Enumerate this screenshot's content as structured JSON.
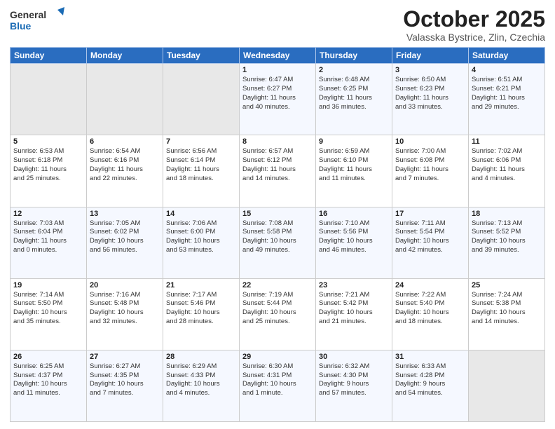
{
  "header": {
    "logo_line1": "General",
    "logo_line2": "Blue",
    "month": "October 2025",
    "location": "Valasska Bystrice, Zlin, Czechia"
  },
  "weekdays": [
    "Sunday",
    "Monday",
    "Tuesday",
    "Wednesday",
    "Thursday",
    "Friday",
    "Saturday"
  ],
  "weeks": [
    [
      {
        "day": "",
        "info": ""
      },
      {
        "day": "",
        "info": ""
      },
      {
        "day": "",
        "info": ""
      },
      {
        "day": "1",
        "info": "Sunrise: 6:47 AM\nSunset: 6:27 PM\nDaylight: 11 hours\nand 40 minutes."
      },
      {
        "day": "2",
        "info": "Sunrise: 6:48 AM\nSunset: 6:25 PM\nDaylight: 11 hours\nand 36 minutes."
      },
      {
        "day": "3",
        "info": "Sunrise: 6:50 AM\nSunset: 6:23 PM\nDaylight: 11 hours\nand 33 minutes."
      },
      {
        "day": "4",
        "info": "Sunrise: 6:51 AM\nSunset: 6:21 PM\nDaylight: 11 hours\nand 29 minutes."
      }
    ],
    [
      {
        "day": "5",
        "info": "Sunrise: 6:53 AM\nSunset: 6:18 PM\nDaylight: 11 hours\nand 25 minutes."
      },
      {
        "day": "6",
        "info": "Sunrise: 6:54 AM\nSunset: 6:16 PM\nDaylight: 11 hours\nand 22 minutes."
      },
      {
        "day": "7",
        "info": "Sunrise: 6:56 AM\nSunset: 6:14 PM\nDaylight: 11 hours\nand 18 minutes."
      },
      {
        "day": "8",
        "info": "Sunrise: 6:57 AM\nSunset: 6:12 PM\nDaylight: 11 hours\nand 14 minutes."
      },
      {
        "day": "9",
        "info": "Sunrise: 6:59 AM\nSunset: 6:10 PM\nDaylight: 11 hours\nand 11 minutes."
      },
      {
        "day": "10",
        "info": "Sunrise: 7:00 AM\nSunset: 6:08 PM\nDaylight: 11 hours\nand 7 minutes."
      },
      {
        "day": "11",
        "info": "Sunrise: 7:02 AM\nSunset: 6:06 PM\nDaylight: 11 hours\nand 4 minutes."
      }
    ],
    [
      {
        "day": "12",
        "info": "Sunrise: 7:03 AM\nSunset: 6:04 PM\nDaylight: 11 hours\nand 0 minutes."
      },
      {
        "day": "13",
        "info": "Sunrise: 7:05 AM\nSunset: 6:02 PM\nDaylight: 10 hours\nand 56 minutes."
      },
      {
        "day": "14",
        "info": "Sunrise: 7:06 AM\nSunset: 6:00 PM\nDaylight: 10 hours\nand 53 minutes."
      },
      {
        "day": "15",
        "info": "Sunrise: 7:08 AM\nSunset: 5:58 PM\nDaylight: 10 hours\nand 49 minutes."
      },
      {
        "day": "16",
        "info": "Sunrise: 7:10 AM\nSunset: 5:56 PM\nDaylight: 10 hours\nand 46 minutes."
      },
      {
        "day": "17",
        "info": "Sunrise: 7:11 AM\nSunset: 5:54 PM\nDaylight: 10 hours\nand 42 minutes."
      },
      {
        "day": "18",
        "info": "Sunrise: 7:13 AM\nSunset: 5:52 PM\nDaylight: 10 hours\nand 39 minutes."
      }
    ],
    [
      {
        "day": "19",
        "info": "Sunrise: 7:14 AM\nSunset: 5:50 PM\nDaylight: 10 hours\nand 35 minutes."
      },
      {
        "day": "20",
        "info": "Sunrise: 7:16 AM\nSunset: 5:48 PM\nDaylight: 10 hours\nand 32 minutes."
      },
      {
        "day": "21",
        "info": "Sunrise: 7:17 AM\nSunset: 5:46 PM\nDaylight: 10 hours\nand 28 minutes."
      },
      {
        "day": "22",
        "info": "Sunrise: 7:19 AM\nSunset: 5:44 PM\nDaylight: 10 hours\nand 25 minutes."
      },
      {
        "day": "23",
        "info": "Sunrise: 7:21 AM\nSunset: 5:42 PM\nDaylight: 10 hours\nand 21 minutes."
      },
      {
        "day": "24",
        "info": "Sunrise: 7:22 AM\nSunset: 5:40 PM\nDaylight: 10 hours\nand 18 minutes."
      },
      {
        "day": "25",
        "info": "Sunrise: 7:24 AM\nSunset: 5:38 PM\nDaylight: 10 hours\nand 14 minutes."
      }
    ],
    [
      {
        "day": "26",
        "info": "Sunrise: 6:25 AM\nSunset: 4:37 PM\nDaylight: 10 hours\nand 11 minutes."
      },
      {
        "day": "27",
        "info": "Sunrise: 6:27 AM\nSunset: 4:35 PM\nDaylight: 10 hours\nand 7 minutes."
      },
      {
        "day": "28",
        "info": "Sunrise: 6:29 AM\nSunset: 4:33 PM\nDaylight: 10 hours\nand 4 minutes."
      },
      {
        "day": "29",
        "info": "Sunrise: 6:30 AM\nSunset: 4:31 PM\nDaylight: 10 hours\nand 1 minute."
      },
      {
        "day": "30",
        "info": "Sunrise: 6:32 AM\nSunset: 4:30 PM\nDaylight: 9 hours\nand 57 minutes."
      },
      {
        "day": "31",
        "info": "Sunrise: 6:33 AM\nSunset: 4:28 PM\nDaylight: 9 hours\nand 54 minutes."
      },
      {
        "day": "",
        "info": ""
      }
    ]
  ]
}
